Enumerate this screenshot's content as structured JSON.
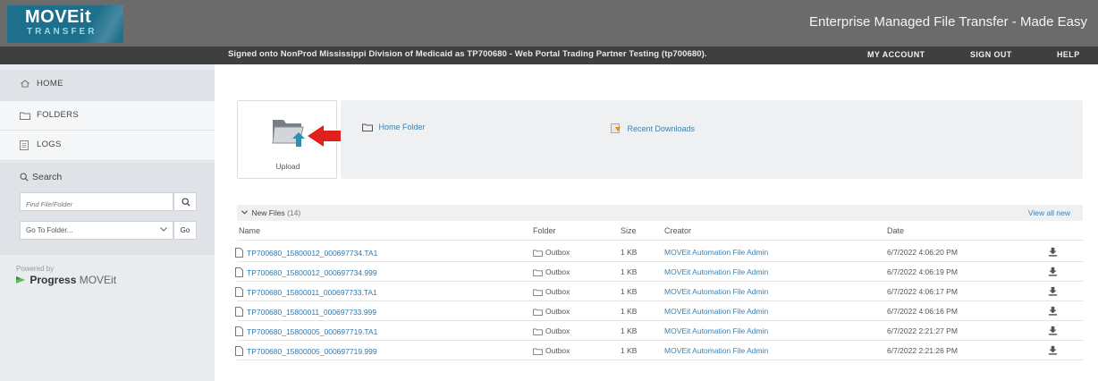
{
  "header": {
    "logo_line1": "MOVEit",
    "logo_line2": "TRANSFER",
    "tagline": "Enterprise Managed File Transfer - Made Easy"
  },
  "infobar": {
    "signed_on": "Signed onto NonProd Mississippi Division of Medicaid as TP700680 - Web Portal Trading Partner Testing (tp700680).",
    "my_account": "MY ACCOUNT",
    "sign_out": "SIGN OUT",
    "help": "HELP"
  },
  "sidebar": {
    "home": "HOME",
    "folders": "FOLDERS",
    "logs": "LOGS",
    "search_title": "Search",
    "search_placeholder": "Find File/Folder",
    "goto_folder": "Go To Folder...",
    "go": "Go",
    "powered_by": "Powered by",
    "progress_name": "Progress",
    "moveit_name": "MOVEit"
  },
  "main": {
    "upload_label": "Upload",
    "home_folder": "Home Folder",
    "recent_downloads": "Recent Downloads",
    "new_files_label": "New Files",
    "new_files_count": "(14)",
    "view_all_new": "View all new",
    "columns": {
      "name": "Name",
      "folder": "Folder",
      "size": "Size",
      "creator": "Creator",
      "date": "Date"
    },
    "rows": [
      {
        "name": "TP700680_15800012_000697734.TA1",
        "folder": "Outbox",
        "size": "1 KB",
        "creator": "MOVEit Automation File Admin",
        "date": "6/7/2022 4:06:20 PM"
      },
      {
        "name": "TP700680_15800012_000697734.999",
        "folder": "Outbox",
        "size": "1 KB",
        "creator": "MOVEit Automation File Admin",
        "date": "6/7/2022 4:06:19 PM"
      },
      {
        "name": "TP700680_15800011_000697733.TA1",
        "folder": "Outbox",
        "size": "1 KB",
        "creator": "MOVEit Automation File Admin",
        "date": "6/7/2022 4:06:17 PM"
      },
      {
        "name": "TP700680_15800011_000697733.999",
        "folder": "Outbox",
        "size": "1 KB",
        "creator": "MOVEit Automation File Admin",
        "date": "6/7/2022 4:06:16 PM"
      },
      {
        "name": "TP700680_15800005_000697719.TA1",
        "folder": "Outbox",
        "size": "1 KB",
        "creator": "MOVEit Automation File Admin",
        "date": "6/7/2022 2:21:27 PM"
      },
      {
        "name": "TP700680_15800005_000697719.999",
        "folder": "Outbox",
        "size": "1 KB",
        "creator": "MOVEit Automation File Admin",
        "date": "6/7/2022 2:21:26 PM"
      }
    ]
  },
  "colors": {
    "header_bg": "#6b6b6b",
    "infobar_bg": "#3f3f3f",
    "logo_bg": "#1e6f8c",
    "link": "#2d7ab0",
    "annotation_arrow": "#e0201b"
  },
  "icons": {
    "home": "home-icon",
    "folders": "folder-icon",
    "logs": "log-icon",
    "search": "search-icon",
    "upload": "upload-folder-icon",
    "file": "file-icon",
    "download": "download-icon",
    "arrow": "red-arrow-annotation"
  }
}
